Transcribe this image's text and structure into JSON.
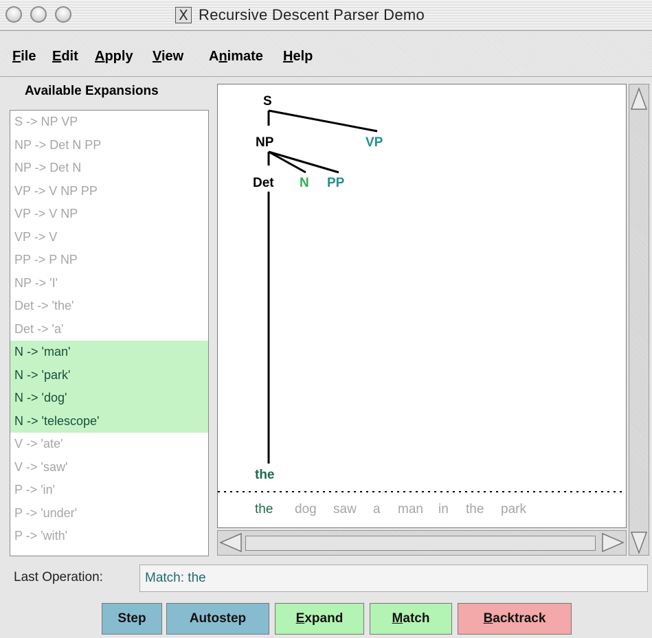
{
  "window": {
    "title": "Recursive Descent Parser Demo",
    "x_glyph": "X"
  },
  "menu": [
    "File",
    "Edit",
    "Apply",
    "View",
    "Animate",
    "Help"
  ],
  "expansions": {
    "header": "Available Expansions",
    "items": [
      "S -> NP VP",
      "NP -> Det N PP",
      "NP -> Det N",
      "VP -> V NP PP",
      "VP -> V NP",
      "VP -> V",
      "PP -> P NP",
      "NP -> 'I'",
      "Det -> 'the'",
      "Det -> 'a'",
      "N -> 'man'",
      "N -> 'park'",
      "N -> 'dog'",
      "N -> 'telescope'",
      "V -> 'ate'",
      "V -> 'saw'",
      "P -> 'in'",
      "P -> 'under'",
      "P -> 'with'"
    ],
    "highlighted": [
      "N -> 'man'",
      "N -> 'park'",
      "N -> 'dog'",
      "N -> 'telescope'"
    ]
  },
  "tree": {
    "S": "S",
    "NP": "NP",
    "VP": "VP",
    "Det": "Det",
    "N": "N",
    "PP": "PP",
    "leaf": "the"
  },
  "sentence": [
    "the",
    "dog",
    "saw",
    "a",
    "man",
    "in",
    "the",
    "park"
  ],
  "last_operation": {
    "label": "Last Operation:",
    "value": "Match: the"
  },
  "buttons": {
    "step": "Step",
    "autostep": "Autostep",
    "expand": "Expand",
    "match": "Match",
    "backtrack": "Backtrack"
  },
  "colors": {
    "matched": "#1b6b4a",
    "frontier": "#21918a",
    "expandable": "#30b050",
    "highlight_bg": "#c6f3c6"
  }
}
